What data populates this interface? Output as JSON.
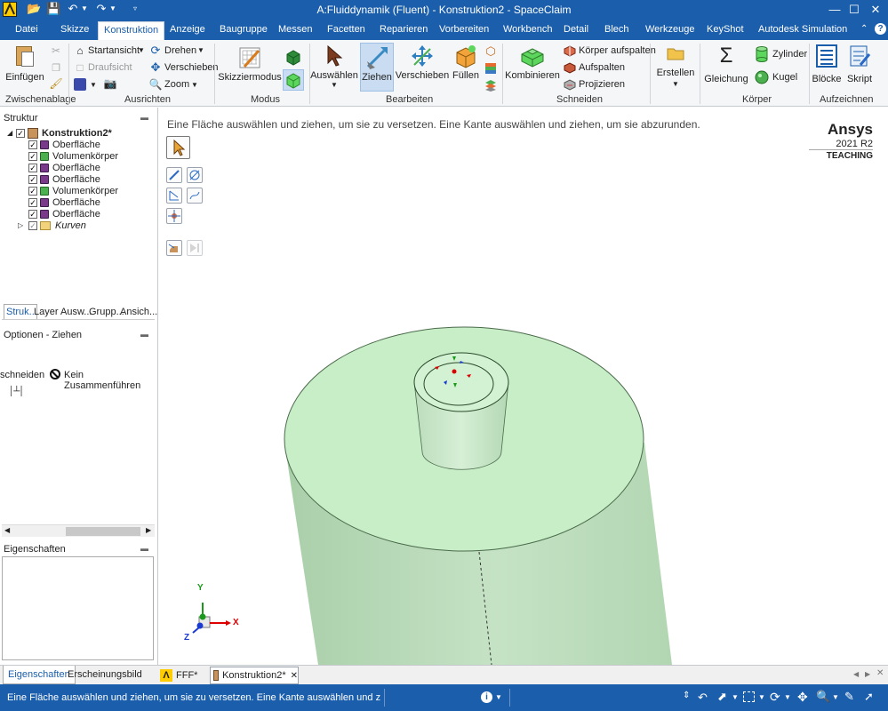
{
  "window": {
    "title": "A:Fluiddynamik (Fluent) - Konstruktion2 - SpaceClaim",
    "controls": [
      "—",
      "☐",
      "✕"
    ]
  },
  "menu": {
    "tabs": [
      "Datei",
      "Skizze",
      "Konstruktion",
      "Anzeige",
      "Baugruppe",
      "Messen",
      "Facetten",
      "Reparieren",
      "Vorbereiten",
      "Workbench",
      "Detail",
      "Blech",
      "Werkzeuge",
      "KeyShot",
      "Autodesk Simulation"
    ],
    "active": "Konstruktion"
  },
  "ribbon": {
    "clipboard": {
      "paste_label": "Einfügen",
      "group_label": "Zwischenablage"
    },
    "orient": {
      "home_view": "Startansicht",
      "top_view": "Draufsicht",
      "rotate": "Drehen",
      "pan": "Verschieben",
      "zoom": "Zoom",
      "group_label": "Ausrichten"
    },
    "mode": {
      "sketch_mode": "Skizziermodus",
      "group_label": "Modus"
    },
    "edit": {
      "select": "Auswählen",
      "pull": "Ziehen",
      "move": "Verschieben",
      "fill": "Füllen",
      "group_label": "Bearbeiten"
    },
    "intersect": {
      "combine": "Kombinieren",
      "split_body": "Körper aufspalten",
      "split": "Aufspalten",
      "project": "Projizieren",
      "group_label": "Schneiden"
    },
    "create": {
      "create": "Erstellen"
    },
    "body": {
      "equation": "Gleichung",
      "cylinder": "Zylinder",
      "sphere": "Kugel",
      "group_label": "Körper"
    },
    "record": {
      "blocks": "Blöcke",
      "script": "Skript",
      "group_label": "Aufzeichnen"
    }
  },
  "structure": {
    "title": "Struktur",
    "root": "Konstruktion2*",
    "items": [
      {
        "label": "Oberfläche",
        "type": "surface"
      },
      {
        "label": "Volumenkörper",
        "type": "solid"
      },
      {
        "label": "Oberfläche",
        "type": "surface"
      },
      {
        "label": "Oberfläche",
        "type": "surface"
      },
      {
        "label": "Volumenkörper",
        "type": "solid"
      },
      {
        "label": "Oberfläche",
        "type": "surface"
      },
      {
        "label": "Oberfläche",
        "type": "surface"
      }
    ],
    "curves": "Kurven",
    "tabs": [
      "Struk..",
      "Layer",
      "Ausw...",
      "Grupp...",
      "Ansich..."
    ]
  },
  "options": {
    "title": "Optionen - Ziehen",
    "intersect": "schneiden",
    "no_merge": "Kein Zusammenführen"
  },
  "properties": {
    "title": "Eigenschaften"
  },
  "left_bottom_tabs": [
    "Eigenschaften",
    "Erscheinungsbild"
  ],
  "viewport": {
    "hint": "Eine Fläche auswählen und ziehen, um sie zu versetzen. Eine Kante auswählen und ziehen, um sie abzurunden.",
    "brand": {
      "name": "Ansys",
      "version": "2021",
      "release": "R2",
      "edition": "TEACHING"
    },
    "axes": {
      "y": "Y",
      "x": "X",
      "z": "Z"
    },
    "colors": {
      "body": "#c3e6c3",
      "body_dark": "#a8cda8",
      "edge": "#4a6a4a"
    }
  },
  "doc_tabs": [
    {
      "label": "FFF*",
      "active": false
    },
    {
      "label": "Konstruktion2*",
      "active": true
    }
  ],
  "status": {
    "message": "Eine Fläche auswählen und ziehen, um sie zu versetzen. Eine Kante auswählen und ziehen, um sie ab"
  }
}
